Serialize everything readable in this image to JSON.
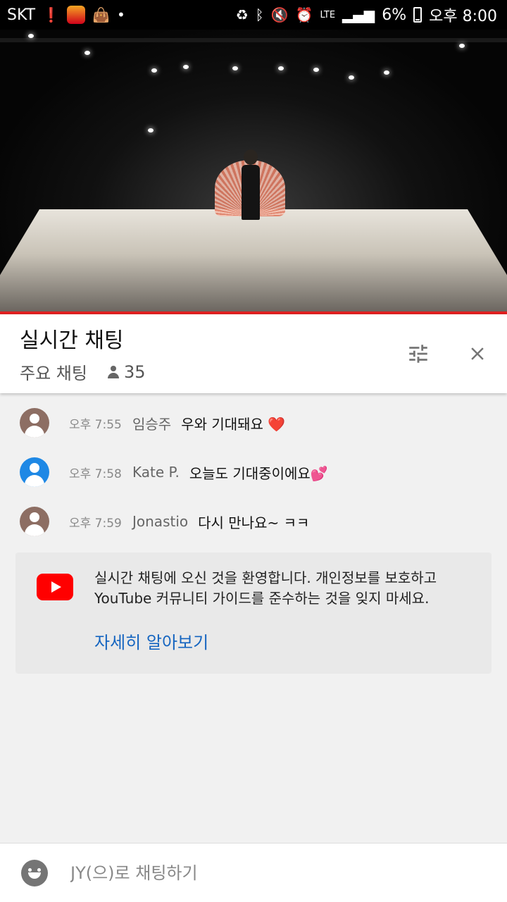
{
  "status_bar": {
    "carrier": "SKT",
    "battery": "6%",
    "time": "오후 8:00",
    "network": "LTE",
    "icons": [
      "alert-icon",
      "app-badge-icon",
      "shopping-bag-icon",
      "dot-icon",
      "recycle-icon",
      "bluetooth-icon",
      "mute-icon",
      "alarm-icon",
      "signal-icon",
      "battery-icon"
    ]
  },
  "chat": {
    "title": "실시간 채팅",
    "mode": "주요 채팅",
    "viewer_count": "35"
  },
  "messages": [
    {
      "time": "오후 7:55",
      "author": "임승주",
      "text": "우와 기대돼요",
      "emoji": "❤️",
      "avatar_color": "#8d6e63"
    },
    {
      "time": "오후 7:58",
      "author": "Kate P.",
      "text": "오늘도 기대중이에요",
      "emoji": "💕",
      "avatar_color": "#1e88e5"
    },
    {
      "time": "오후 7:59",
      "author": "Jonastio",
      "text": "다시 만나요~ ㅋㅋ",
      "emoji": "",
      "avatar_color": "#8d6e63"
    }
  ],
  "welcome": {
    "text": "실시간 채팅에 오신 것을 환영합니다. 개인정보를 보호하고 YouTube 커뮤니티 가이드를 준수하는 것을 잊지 마세요.",
    "learn_more": "자세히 알아보기"
  },
  "input": {
    "placeholder": "JY(으)로 채팅하기"
  },
  "colors": {
    "progress": "#e02020",
    "link": "#1565c0",
    "youtube_red": "#ff0000"
  }
}
